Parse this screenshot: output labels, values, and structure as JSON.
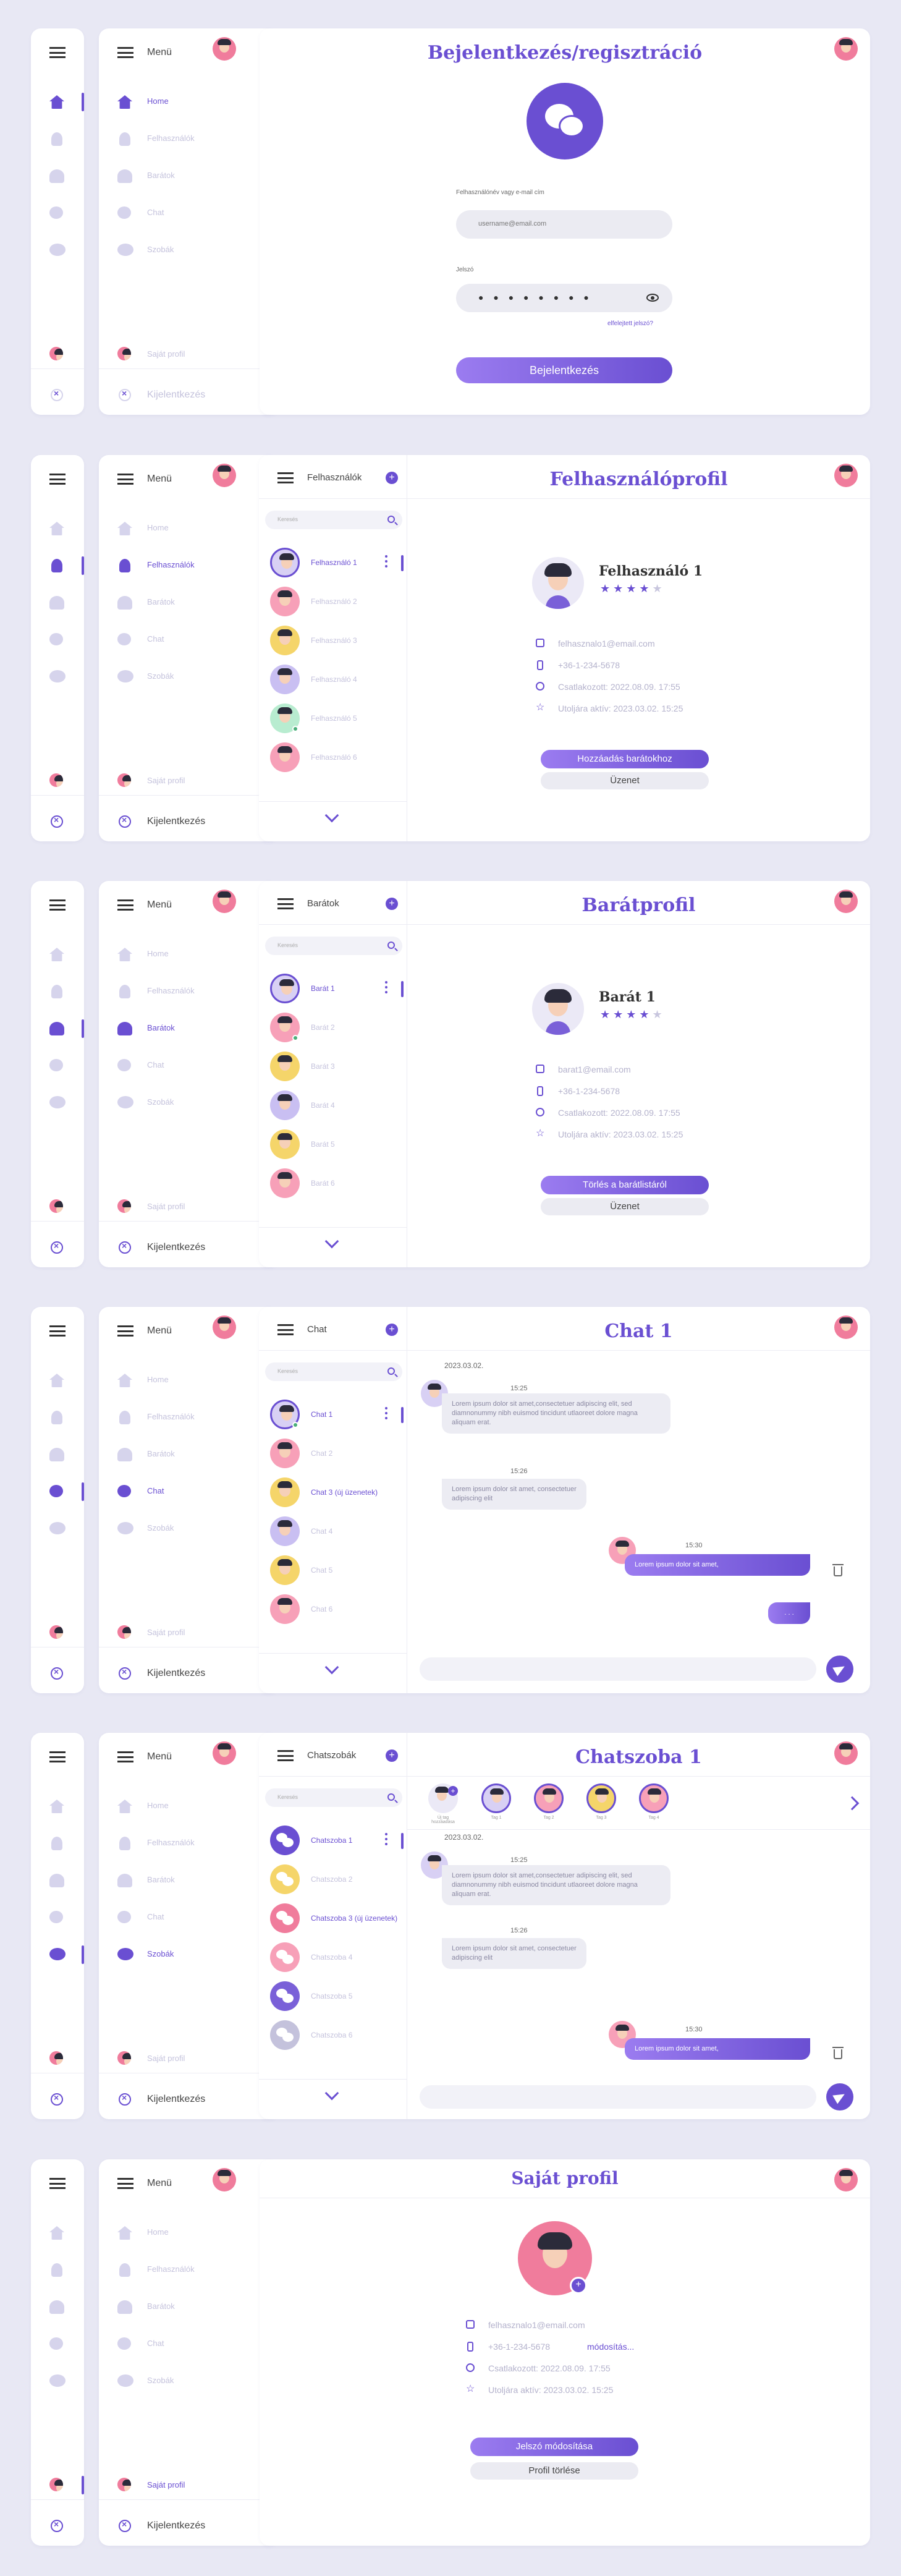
{
  "menu": {
    "title": "Menü",
    "items": [
      "Home",
      "Felhasználók",
      "Barátok",
      "Chat",
      "Szobák"
    ],
    "own_profile": "Saját profil",
    "logout": "Kijelentkezés"
  },
  "login": {
    "title": "Bejelentkezés/regisztráció",
    "user_label": "Felhasználónév vagy e-mail cím",
    "user_value": "username@email.com",
    "pw_label": "Jelszó",
    "pw_value": "● ● ● ● ● ● ● ●",
    "forgot": "elfelejtett jelszó?",
    "submit": "Bejelentkezés"
  },
  "users": {
    "list_title": "Felhasználók",
    "search": "Keresés",
    "items": [
      "Felhasználó 1",
      "Felhasználó 2",
      "Felhasználó 3",
      "Felhasználó 4",
      "Felhasználó 5",
      "Felhasználó 6"
    ],
    "page_title": "Felhasználóprofil",
    "name": "Felhasználó 1",
    "email": "felhasznalo1@email.com",
    "phone": "+36-1-234-5678",
    "joined": "Csatlakozott: 2022.08.09. 17:55",
    "last_active": "Utoljára aktív: 2023.03.02. 15:25",
    "primary": "Hozzáadás barátokhoz",
    "secondary": "Üzenet"
  },
  "friends": {
    "list_title": "Barátok",
    "search": "Keresés",
    "items": [
      "Barát 1",
      "Barát 2",
      "Barát 3",
      "Barát 4",
      "Barát 5",
      "Barát 6"
    ],
    "page_title": "Barátprofil",
    "name": "Barát 1",
    "email": "barat1@email.com",
    "phone": "+36-1-234-5678",
    "joined": "Csatlakozott: 2022.08.09. 17:55",
    "last_active": "Utoljára aktív: 2023.03.02. 15:25",
    "primary": "Törlés a barátlistáról",
    "secondary": "Üzenet"
  },
  "chat": {
    "list_title": "Chat",
    "search": "Keresés",
    "items": [
      "Chat 1",
      "Chat 2",
      "Chat 3 (új üzenetek)",
      "Chat 4",
      "Chat 5",
      "Chat 6"
    ],
    "page_title": "Chat 1",
    "date": "2023.03.02.",
    "t1": "15:25",
    "m1": "Lorem ipsum dolor sit amet,consectetuer adipiscing elit, sed diamnonummy nibh euismod tincidunt utlaoreet dolore magna aliquam erat.",
    "t2": "15:26",
    "m2": "Lorem ipsum dolor sit amet, consectetuer adipiscing elit",
    "t3": "15:30",
    "m3": "Lorem ipsum dolor sit amet,",
    "m4": ". . ."
  },
  "rooms": {
    "list_title": "Chatszobák",
    "search": "Keresés",
    "items": [
      "Chatszoba 1",
      "Chatszoba 2",
      "Chatszoba 3 (új üzenetek)",
      "Chatszoba 4",
      "Chatszoba 5",
      "Chatszoba 6"
    ],
    "page_title": "Chatszoba 1",
    "add_member": "Új tag hozzáadása",
    "members": [
      "Tag 1",
      "Tag 2",
      "Tag 3",
      "Tag 4"
    ],
    "date": "2023.03.02.",
    "t1": "15:25",
    "m1": "Lorem ipsum dolor sit amet,consectetuer adipiscing elit, sed diamnonummy nibh euismod tincidunt utlaoreet dolore magna aliquam erat.",
    "t2": "15:26",
    "m2": "Lorem ipsum dolor sit amet, consectetuer adipiscing elit",
    "t3": "15:30",
    "m3": "Lorem ipsum dolor sit amet,"
  },
  "own": {
    "page_title": "Saját profil",
    "email": "felhasznalo1@email.com",
    "phone": "+36-1-234-5678",
    "edit": "módosítás...",
    "joined": "Csatlakozott: 2022.08.09. 17:55",
    "last_active": "Utoljára aktív: 2023.03.02. 15:25",
    "primary": "Jelszó módosítása",
    "secondary": "Profil törlése"
  },
  "colors": {
    "accent": "#6a4fd2",
    "background": "#e8e8f4",
    "online": "#4caf7a"
  }
}
